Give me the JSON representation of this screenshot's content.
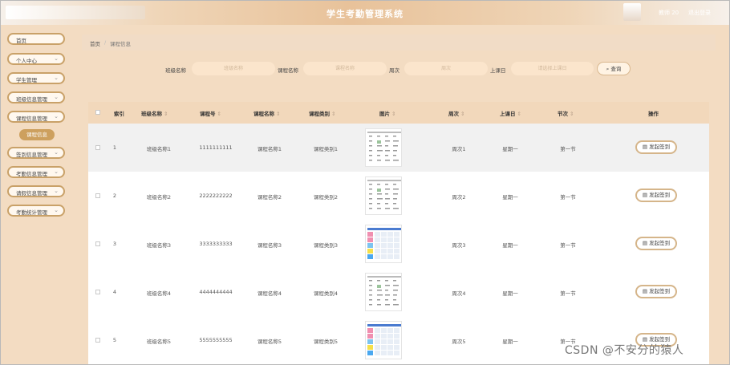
{
  "app": {
    "title": "学生考勤管理系统",
    "user": "教师 20",
    "logout": "退出登录"
  },
  "sidebar": {
    "items": [
      {
        "label": "首页",
        "has_chevron": false
      },
      {
        "label": "个人中心",
        "has_chevron": true
      },
      {
        "label": "学生管理",
        "has_chevron": true
      },
      {
        "label": "班级信息管理",
        "has_chevron": true
      },
      {
        "label": "课程信息管理",
        "has_chevron": true
      },
      {
        "label": "签到信息管理",
        "has_chevron": true
      },
      {
        "label": "考勤信息管理",
        "has_chevron": true
      },
      {
        "label": "请假信息管理",
        "has_chevron": true
      },
      {
        "label": "考勤统计管理",
        "has_chevron": true
      }
    ],
    "sub_item": "课程信息",
    "chevron_icon": "chevron-down-icon"
  },
  "breadcrumb": {
    "home": "首页",
    "sep": "/",
    "current": "课程信息"
  },
  "search": {
    "class_label": "班级名称",
    "class_placeholder": "班级名称",
    "course_label": "课程名称",
    "course_placeholder": "课程名称",
    "week_label": "周次",
    "week_placeholder": "周次",
    "day_label": "上课日",
    "day_placeholder": "请选择上课日",
    "button": "查询",
    "button_icon": "search-icon"
  },
  "table": {
    "headers": {
      "index": "索引",
      "class_name": "班级名称",
      "course_no": "课程号",
      "course_name": "课程名称",
      "course_type": "课程类别",
      "image": "图片",
      "week": "周次",
      "day": "上课日",
      "section": "节次",
      "actions": "操作"
    },
    "sort_icon": "sort-icon",
    "rows": [
      {
        "index": "1",
        "class_name": "班级名称1",
        "course_no": "1111111111",
        "course_name": "课程名称1",
        "course_type": "课程类别1",
        "week": "周次1",
        "day": "星期一",
        "section": "第一节",
        "action": "发起签到",
        "thumb": "plain"
      },
      {
        "index": "2",
        "class_name": "班级名称2",
        "course_no": "2222222222",
        "course_name": "课程名称2",
        "course_type": "课程类别2",
        "week": "周次2",
        "day": "星期一",
        "section": "第一节",
        "action": "发起签到",
        "thumb": "plain"
      },
      {
        "index": "3",
        "class_name": "班级名称3",
        "course_no": "3333333333",
        "course_name": "课程名称3",
        "course_type": "课程类别3",
        "week": "周次3",
        "day": "星期一",
        "section": "第一节",
        "action": "发起签到",
        "thumb": "color"
      },
      {
        "index": "4",
        "class_name": "班级名称4",
        "course_no": "4444444444",
        "course_name": "课程名称4",
        "course_type": "课程类别4",
        "week": "周次4",
        "day": "星期一",
        "section": "第一节",
        "action": "发起签到",
        "thumb": "plain"
      },
      {
        "index": "5",
        "class_name": "班级名称5",
        "course_no": "5555555555",
        "course_name": "课程名称5",
        "course_type": "课程类别5",
        "week": "周次5",
        "day": "星期一",
        "section": "第一节",
        "action": "发起签到",
        "thumb": "color"
      }
    ],
    "action_icon": "document-icon"
  },
  "watermark": "CSDN @不安分的猿人",
  "colors": {
    "accent": "#cda05e",
    "header_bg": "#f2d8bb",
    "sidebar_bg": "#f3dcc2"
  }
}
